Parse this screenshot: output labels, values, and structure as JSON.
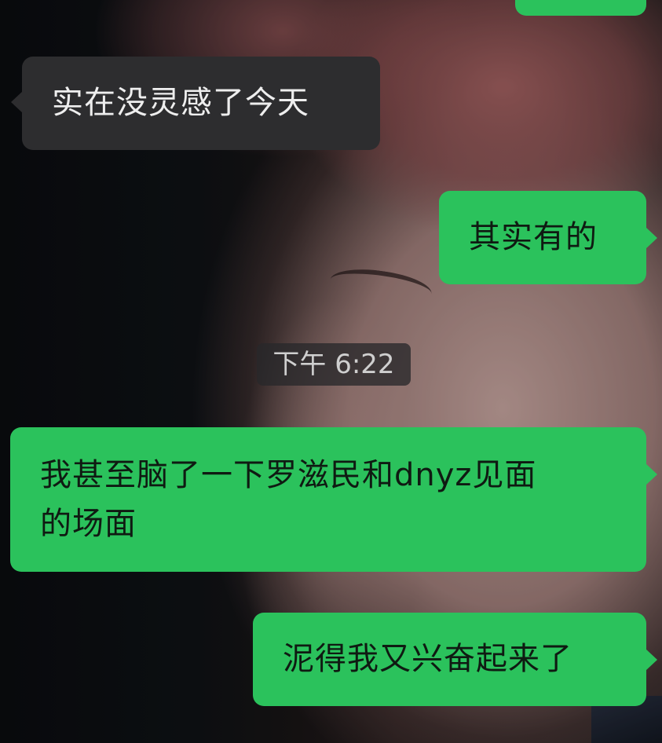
{
  "background": {
    "description_icon": "portrait-photo-icon"
  },
  "timestamp": "下午 6:22",
  "messages": [
    {
      "side": "right",
      "text": ""
    },
    {
      "side": "left",
      "text": "实在没灵感了今天"
    },
    {
      "side": "right",
      "text": "其实有的"
    },
    {
      "side": "right",
      "lines": [
        "我甚至脑了一下罗滋民和dnyz见面",
        "的场面"
      ]
    },
    {
      "side": "right",
      "text": "泥得我又兴奋起来了"
    }
  ],
  "colors": {
    "outgoing_bubble": "#2bc25c",
    "incoming_bubble": "#2d2d2f",
    "timestamp_badge": "#28282a"
  }
}
